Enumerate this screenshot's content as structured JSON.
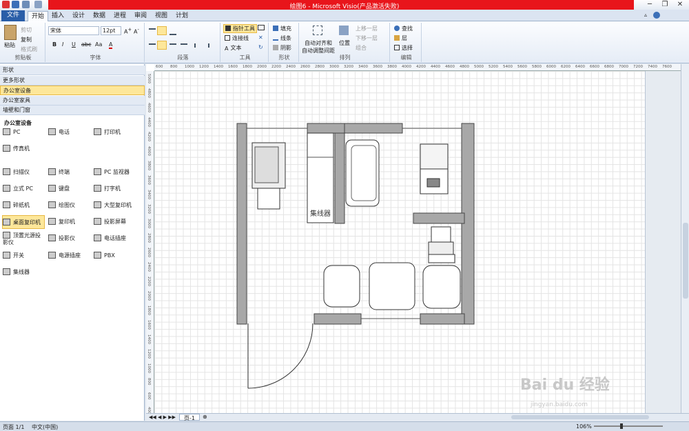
{
  "window": {
    "title": "绘图6 - Microsoft Visio(产品激活失败)"
  },
  "tabs": [
    "文件",
    "开始",
    "插入",
    "设计",
    "数据",
    "进程",
    "审阅",
    "视图",
    "计划"
  ],
  "ribbon": {
    "clipboard": {
      "paste": "粘贴",
      "cut": "剪切",
      "copy": "复制",
      "format_painter": "格式刷",
      "label": "剪贴板"
    },
    "font": {
      "name": "宋体",
      "size": "12pt",
      "bold": "B",
      "italic": "I",
      "underline": "U",
      "strike": "abc",
      "color": "A",
      "label": "字体"
    },
    "paragraph": {
      "label": "段落"
    },
    "tools": {
      "pointer": "指针工具",
      "connector": "连接线",
      "text": "文本",
      "label": "工具"
    },
    "shape": {
      "fill": "填充",
      "line": "线条",
      "shadow": "阴影",
      "label": "形状"
    },
    "arrange": {
      "auto_align": "自动对齐和",
      "auto_align2": "自动调整间距",
      "position": "位置",
      "bring_forward": "上移一层",
      "send_backward": "下移一层",
      "group": "组合",
      "label": "排列"
    },
    "edit": {
      "find": "查找",
      "layer": "层",
      "select": "选择",
      "label": "编辑"
    }
  },
  "panel": {
    "header": "形状",
    "more_shapes": "更多形状",
    "stencils": [
      "办公室设备",
      "办公室家具",
      "墙壁和门窗"
    ],
    "section_title": "办公室设备",
    "shapes": [
      [
        "PC",
        "电话",
        "打印机"
      ],
      [
        "传真机"
      ],
      [
        "扫描仪",
        "终端",
        "PC 监视器"
      ],
      [
        "立式 PC",
        "键盘",
        "打字机"
      ],
      [
        "碎纸机",
        "绘图仪",
        "大型复印机"
      ],
      [
        "桌面复印机",
        "复印机",
        "投影屏幕"
      ],
      [
        "顶置光源投影仪",
        "投影仪",
        "电话插座"
      ],
      [
        "开关",
        "电源插座",
        "PBX"
      ],
      [
        "集线器"
      ]
    ]
  },
  "ruler": {
    "h": [
      "600",
      "800",
      "1000",
      "1200",
      "1400",
      "1600",
      "1800",
      "2000",
      "2200",
      "2400",
      "2600",
      "2800",
      "3000",
      "3200",
      "3400",
      "3600",
      "3800",
      "4000",
      "4200",
      "4400",
      "4600",
      "4800",
      "5000",
      "5200",
      "5400",
      "5600",
      "5800",
      "6000",
      "6200",
      "6400",
      "6600",
      "6800",
      "7000",
      "7200",
      "7400",
      "7600"
    ],
    "v": [
      "5000",
      "4800",
      "4600",
      "4400",
      "4200",
      "4000",
      "3800",
      "3600",
      "3400",
      "3200",
      "3000",
      "2800",
      "2600",
      "2400",
      "2200",
      "2000",
      "1800",
      "1600",
      "1400",
      "1200",
      "1000",
      "800",
      "600",
      "400"
    ]
  },
  "drawing": {
    "hub_label": "集线器"
  },
  "pagetabs": {
    "page": "页-1"
  },
  "status": {
    "page": "页面 1/1",
    "language": "中文(中国)",
    "zoom": "106%"
  },
  "watermark": {
    "brand": "Bai du 经验",
    "url": "jingyan.baidu.com"
  },
  "colors": {
    "accent": "#2a5ea8",
    "title_red": "#e8151b",
    "wall": "#a8a8a8",
    "selected": "#fde79a"
  }
}
